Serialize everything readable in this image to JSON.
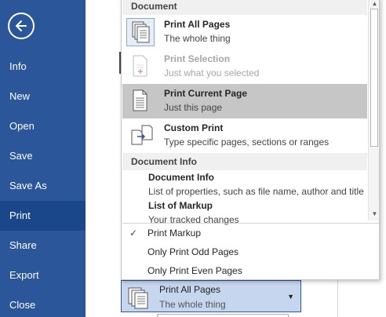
{
  "sidebar": {
    "back_label": "Back",
    "items": [
      {
        "label": "Info"
      },
      {
        "label": "New"
      },
      {
        "label": "Open"
      },
      {
        "label": "Save"
      },
      {
        "label": "Save As"
      },
      {
        "label": "Print",
        "active": true
      },
      {
        "label": "Share"
      },
      {
        "label": "Export"
      },
      {
        "label": "Close"
      }
    ]
  },
  "menu": {
    "document_header": "Document",
    "print_items": [
      {
        "title": "Print All Pages",
        "subtitle": "The whole thing",
        "icon": "pages-stack-icon",
        "state": "current"
      },
      {
        "title": "Print Selection",
        "subtitle": "Just what you selected",
        "icon": "selection-page-icon",
        "state": "disabled"
      },
      {
        "title": "Print Current Page",
        "subtitle": "Just this page",
        "icon": "single-page-icon",
        "state": "hover"
      },
      {
        "title": "Custom Print",
        "subtitle": "Type specific pages, sections or ranges",
        "icon": "custom-print-icon",
        "state": "normal"
      }
    ],
    "document_info_header": "Document Info",
    "info_items": [
      {
        "title": "Document Info",
        "subtitle": "List of properties, such as file name, author and title"
      },
      {
        "title": "List of Markup",
        "subtitle": "Your tracked changes"
      }
    ],
    "options": [
      {
        "label": "Print Markup",
        "checked": true
      },
      {
        "label": "Only Print Odd Pages",
        "checked": false
      },
      {
        "label": "Only Print Even Pages",
        "checked": false
      }
    ],
    "check_glyph": "✓"
  },
  "settings_dropdown": {
    "title": "Print All Pages",
    "subtitle": "The whole thing",
    "arrow": "▼"
  },
  "colors": {
    "sidebar": "#2b579a",
    "sidebar_active": "#19478a",
    "menu_hover": "#c6c6c6",
    "dropdown_bg": "#c5d6ee"
  }
}
